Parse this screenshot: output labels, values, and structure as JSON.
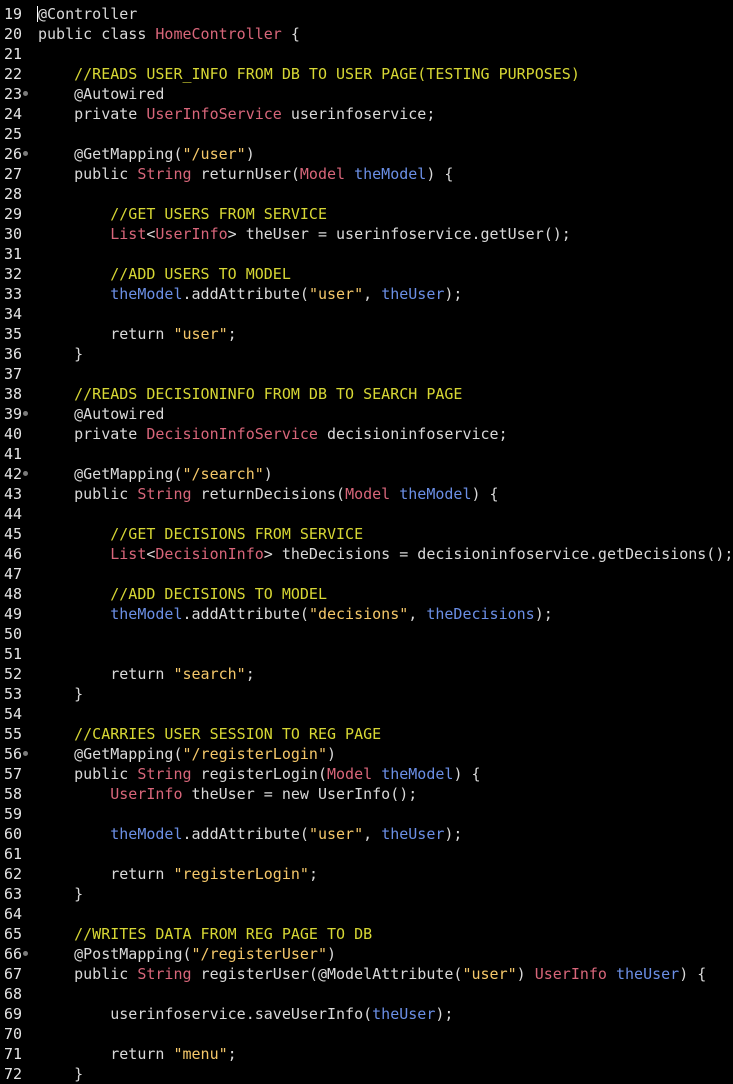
{
  "editor": {
    "lines": [
      {
        "n": "19",
        "fold": false,
        "cursor": true,
        "tokens": [
          [
            "plain",
            "@Controller"
          ]
        ]
      },
      {
        "n": "20",
        "fold": false,
        "tokens": [
          [
            "plain",
            "public class "
          ],
          [
            "type",
            "HomeController"
          ],
          [
            "plain",
            " {"
          ]
        ]
      },
      {
        "n": "21",
        "fold": false,
        "tokens": []
      },
      {
        "n": "22",
        "fold": false,
        "tokens": [
          [
            "plain",
            "    "
          ],
          [
            "comment",
            "//READS USER_INFO FROM DB TO USER PAGE(TESTING PURPOSES)"
          ]
        ]
      },
      {
        "n": "23",
        "fold": true,
        "tokens": [
          [
            "plain",
            "    @Autowired"
          ]
        ]
      },
      {
        "n": "24",
        "fold": false,
        "tokens": [
          [
            "plain",
            "    private "
          ],
          [
            "type",
            "UserInfoService"
          ],
          [
            "plain",
            " userinfoservice;"
          ]
        ]
      },
      {
        "n": "25",
        "fold": false,
        "tokens": []
      },
      {
        "n": "26",
        "fold": true,
        "tokens": [
          [
            "plain",
            "    @GetMapping("
          ],
          [
            "string",
            "\"/user\""
          ],
          [
            "plain",
            ")"
          ]
        ]
      },
      {
        "n": "27",
        "fold": false,
        "tokens": [
          [
            "plain",
            "    public "
          ],
          [
            "type",
            "String"
          ],
          [
            "plain",
            " returnUser("
          ],
          [
            "type",
            "Model"
          ],
          [
            "plain",
            " "
          ],
          [
            "var",
            "theModel"
          ],
          [
            "plain",
            ") {"
          ]
        ]
      },
      {
        "n": "28",
        "fold": false,
        "tokens": []
      },
      {
        "n": "29",
        "fold": false,
        "tokens": [
          [
            "plain",
            "        "
          ],
          [
            "comment",
            "//GET USERS FROM SERVICE"
          ]
        ]
      },
      {
        "n": "30",
        "fold": false,
        "tokens": [
          [
            "plain",
            "        "
          ],
          [
            "type",
            "List"
          ],
          [
            "plain",
            "<"
          ],
          [
            "type",
            "UserInfo"
          ],
          [
            "plain",
            "> theUser = userinfoservice.getUser();"
          ]
        ]
      },
      {
        "n": "31",
        "fold": false,
        "tokens": []
      },
      {
        "n": "32",
        "fold": false,
        "tokens": [
          [
            "plain",
            "        "
          ],
          [
            "comment",
            "//ADD USERS TO MODEL"
          ]
        ]
      },
      {
        "n": "33",
        "fold": false,
        "tokens": [
          [
            "plain",
            "        "
          ],
          [
            "var",
            "theModel"
          ],
          [
            "plain",
            ".addAttribute("
          ],
          [
            "string",
            "\"user\""
          ],
          [
            "plain",
            ", "
          ],
          [
            "var",
            "theUser"
          ],
          [
            "plain",
            ");"
          ]
        ]
      },
      {
        "n": "34",
        "fold": false,
        "tokens": []
      },
      {
        "n": "35",
        "fold": false,
        "tokens": [
          [
            "plain",
            "        return "
          ],
          [
            "string",
            "\"user\""
          ],
          [
            "plain",
            ";"
          ]
        ]
      },
      {
        "n": "36",
        "fold": false,
        "tokens": [
          [
            "plain",
            "    }"
          ]
        ]
      },
      {
        "n": "37",
        "fold": false,
        "tokens": []
      },
      {
        "n": "38",
        "fold": false,
        "tokens": [
          [
            "plain",
            "    "
          ],
          [
            "comment",
            "//READS DECISIONINFO FROM DB TO SEARCH PAGE"
          ]
        ]
      },
      {
        "n": "39",
        "fold": true,
        "tokens": [
          [
            "plain",
            "    @Autowired"
          ]
        ]
      },
      {
        "n": "40",
        "fold": false,
        "tokens": [
          [
            "plain",
            "    private "
          ],
          [
            "type",
            "DecisionInfoService"
          ],
          [
            "plain",
            " decisioninfoservice;"
          ]
        ]
      },
      {
        "n": "41",
        "fold": false,
        "tokens": []
      },
      {
        "n": "42",
        "fold": true,
        "tokens": [
          [
            "plain",
            "    @GetMapping("
          ],
          [
            "string",
            "\"/search\""
          ],
          [
            "plain",
            ")"
          ]
        ]
      },
      {
        "n": "43",
        "fold": false,
        "tokens": [
          [
            "plain",
            "    public "
          ],
          [
            "type",
            "String"
          ],
          [
            "plain",
            " returnDecisions("
          ],
          [
            "type",
            "Model"
          ],
          [
            "plain",
            " "
          ],
          [
            "var",
            "theModel"
          ],
          [
            "plain",
            ") {"
          ]
        ]
      },
      {
        "n": "44",
        "fold": false,
        "tokens": []
      },
      {
        "n": "45",
        "fold": false,
        "tokens": [
          [
            "plain",
            "        "
          ],
          [
            "comment",
            "//GET DECISIONS FROM SERVICE"
          ]
        ]
      },
      {
        "n": "46",
        "fold": false,
        "tokens": [
          [
            "plain",
            "        "
          ],
          [
            "type",
            "List"
          ],
          [
            "plain",
            "<"
          ],
          [
            "type",
            "DecisionInfo"
          ],
          [
            "plain",
            "> theDecisions = decisioninfoservice.getDecisions();"
          ]
        ]
      },
      {
        "n": "47",
        "fold": false,
        "tokens": []
      },
      {
        "n": "48",
        "fold": false,
        "tokens": [
          [
            "plain",
            "        "
          ],
          [
            "comment",
            "//ADD DECISIONS TO MODEL"
          ]
        ]
      },
      {
        "n": "49",
        "fold": false,
        "tokens": [
          [
            "plain",
            "        "
          ],
          [
            "var",
            "theModel"
          ],
          [
            "plain",
            ".addAttribute("
          ],
          [
            "string",
            "\"decisions\""
          ],
          [
            "plain",
            ", "
          ],
          [
            "var",
            "theDecisions"
          ],
          [
            "plain",
            ");"
          ]
        ]
      },
      {
        "n": "50",
        "fold": false,
        "tokens": []
      },
      {
        "n": "51",
        "fold": false,
        "tokens": []
      },
      {
        "n": "52",
        "fold": false,
        "tokens": [
          [
            "plain",
            "        return "
          ],
          [
            "string",
            "\"search\""
          ],
          [
            "plain",
            ";"
          ]
        ]
      },
      {
        "n": "53",
        "fold": false,
        "tokens": [
          [
            "plain",
            "    }"
          ]
        ]
      },
      {
        "n": "54",
        "fold": false,
        "tokens": []
      },
      {
        "n": "55",
        "fold": false,
        "tokens": [
          [
            "plain",
            "    "
          ],
          [
            "comment",
            "//CARRIES USER SESSION TO REG PAGE"
          ]
        ]
      },
      {
        "n": "56",
        "fold": true,
        "tokens": [
          [
            "plain",
            "    @GetMapping("
          ],
          [
            "string",
            "\"/registerLogin\""
          ],
          [
            "plain",
            ")"
          ]
        ]
      },
      {
        "n": "57",
        "fold": false,
        "tokens": [
          [
            "plain",
            "    public "
          ],
          [
            "type",
            "String"
          ],
          [
            "plain",
            " registerLogin("
          ],
          [
            "type",
            "Model"
          ],
          [
            "plain",
            " "
          ],
          [
            "var",
            "theModel"
          ],
          [
            "plain",
            ") {"
          ]
        ]
      },
      {
        "n": "58",
        "fold": false,
        "tokens": [
          [
            "plain",
            "        "
          ],
          [
            "type",
            "UserInfo"
          ],
          [
            "plain",
            " theUser = new UserInfo();"
          ]
        ]
      },
      {
        "n": "59",
        "fold": false,
        "tokens": []
      },
      {
        "n": "60",
        "fold": false,
        "tokens": [
          [
            "plain",
            "        "
          ],
          [
            "var",
            "theModel"
          ],
          [
            "plain",
            ".addAttribute("
          ],
          [
            "string",
            "\"user\""
          ],
          [
            "plain",
            ", "
          ],
          [
            "var",
            "theUser"
          ],
          [
            "plain",
            ");"
          ]
        ]
      },
      {
        "n": "61",
        "fold": false,
        "tokens": []
      },
      {
        "n": "62",
        "fold": false,
        "tokens": [
          [
            "plain",
            "        return "
          ],
          [
            "string",
            "\"registerLogin\""
          ],
          [
            "plain",
            ";"
          ]
        ]
      },
      {
        "n": "63",
        "fold": false,
        "tokens": [
          [
            "plain",
            "    }"
          ]
        ]
      },
      {
        "n": "64",
        "fold": false,
        "tokens": []
      },
      {
        "n": "65",
        "fold": false,
        "tokens": [
          [
            "plain",
            "    "
          ],
          [
            "comment",
            "//WRITES DATA FROM REG PAGE TO DB"
          ]
        ]
      },
      {
        "n": "66",
        "fold": true,
        "tokens": [
          [
            "plain",
            "    @PostMapping("
          ],
          [
            "string",
            "\"/registerUser\""
          ],
          [
            "plain",
            ")"
          ]
        ]
      },
      {
        "n": "67",
        "fold": false,
        "tokens": [
          [
            "plain",
            "    public "
          ],
          [
            "type",
            "String"
          ],
          [
            "plain",
            " registerUser(@ModelAttribute("
          ],
          [
            "string",
            "\"user\""
          ],
          [
            "plain",
            ") "
          ],
          [
            "type",
            "UserInfo"
          ],
          [
            "plain",
            " "
          ],
          [
            "var",
            "theUser"
          ],
          [
            "plain",
            ") {"
          ]
        ]
      },
      {
        "n": "68",
        "fold": false,
        "tokens": []
      },
      {
        "n": "69",
        "fold": false,
        "tokens": [
          [
            "plain",
            "        userinfoservice.saveUserInfo("
          ],
          [
            "var",
            "theUser"
          ],
          [
            "plain",
            ");"
          ]
        ]
      },
      {
        "n": "70",
        "fold": false,
        "tokens": []
      },
      {
        "n": "71",
        "fold": false,
        "tokens": [
          [
            "plain",
            "        return "
          ],
          [
            "string",
            "\"menu\""
          ],
          [
            "plain",
            ";"
          ]
        ]
      },
      {
        "n": "72",
        "fold": false,
        "tokens": [
          [
            "plain",
            "    }"
          ]
        ]
      }
    ]
  },
  "colors": {
    "background": "#000000",
    "comment": "#d7d734",
    "type": "#d8667a",
    "string": "#f5c86a",
    "variable": "#6b8fe6",
    "text": "#d9d9d9"
  }
}
